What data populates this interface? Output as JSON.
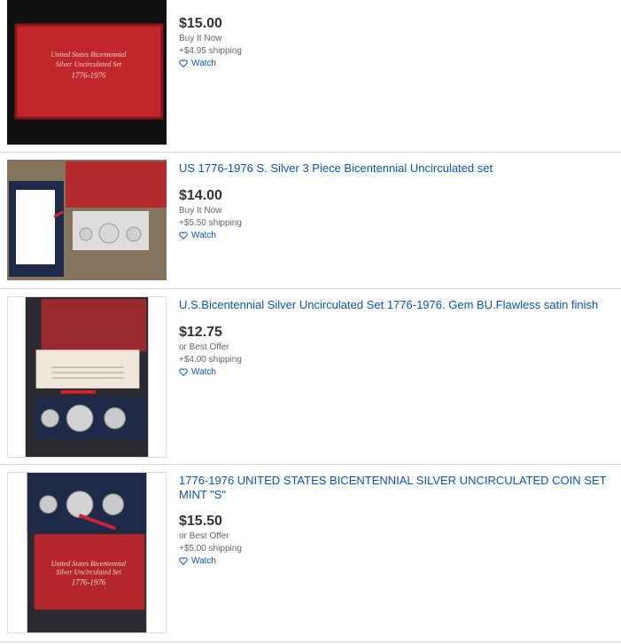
{
  "listings": [
    {
      "title": "",
      "price": "$15.00",
      "format": "Buy It Now",
      "shipping": "+$4.95 shipping",
      "watch_label": "Watch",
      "image_text": [
        "United States Bicentennial",
        "Silver Uncirculated Set",
        "1776-1976"
      ]
    },
    {
      "title": "US 1776-1976 S. Silver 3 Piece Bicentennial Uncirculated set",
      "price": "$14.00",
      "format": "Buy It Now",
      "shipping": "+$5.50 shipping",
      "watch_label": "Watch"
    },
    {
      "title": "U.S.Bicentennial Silver Uncirculated Set 1776-1976. Gem BU.Flawless satin finish",
      "price": "$12.75",
      "format": "or Best Offer",
      "shipping": "+$4.00 shipping",
      "watch_label": "Watch"
    },
    {
      "title": "1776-1976 UNITED STATES BICENTENNIAL SILVER UNCIRCULATED COIN SET MINT \"S\"",
      "price": "$15.50",
      "format": "or Best Offer",
      "shipping": "+$5.00 shipping",
      "watch_label": "Watch"
    }
  ],
  "colors": {
    "link": "#0654ba",
    "price": "#333333",
    "muted": "#666666",
    "divider": "#dddddd"
  },
  "icons": {
    "watch": "heart-outline-icon"
  }
}
